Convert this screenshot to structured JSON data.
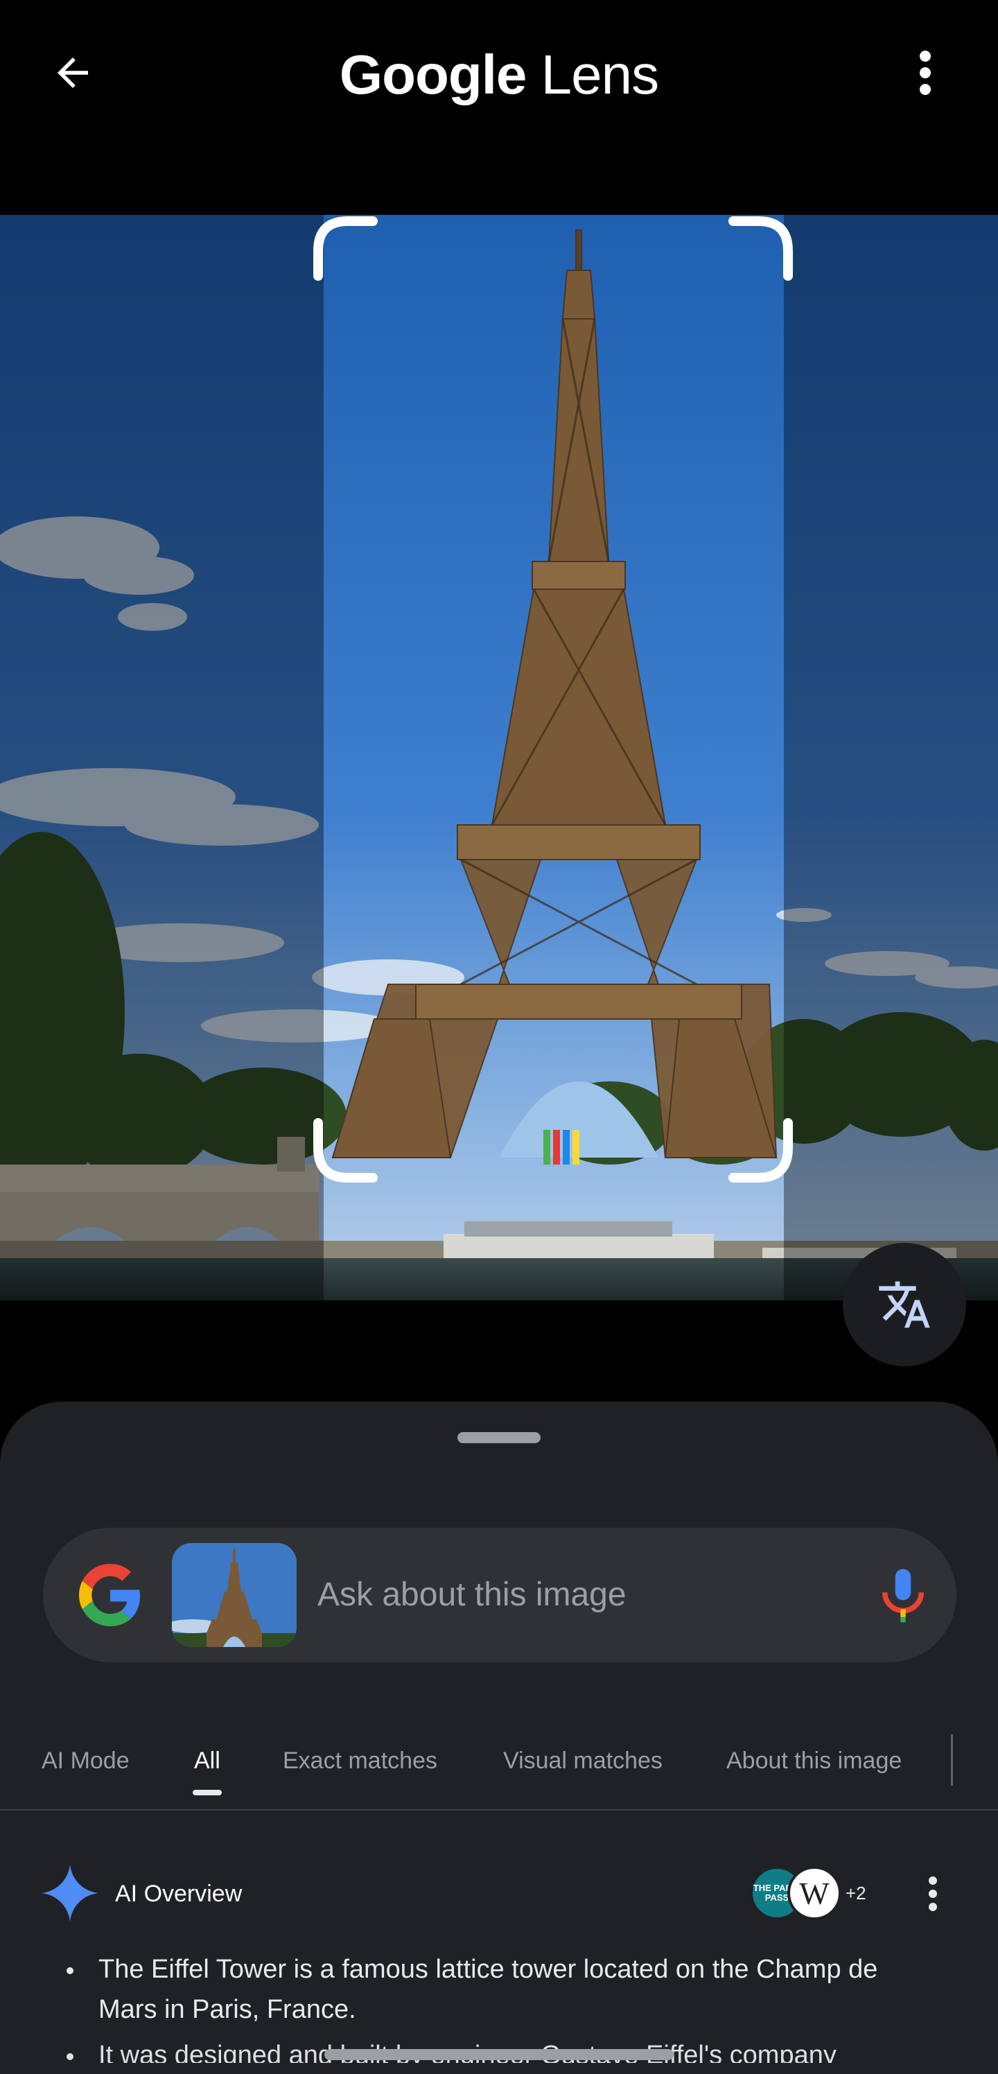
{
  "app_bar": {
    "title_google": "Google",
    "title_lens": "Lens",
    "back_icon": "arrow-left-icon",
    "more_icon": "more-vert-icon"
  },
  "photo": {
    "subject": "eiffel-tower-photo",
    "translate_icon": "translate-icon"
  },
  "search": {
    "placeholder": "Ask about this image",
    "logo_icon": "google-g-icon",
    "mic_icon": "mic-icon"
  },
  "tabs": [
    {
      "label": "AI Mode",
      "active": false
    },
    {
      "label": "All",
      "active": true
    },
    {
      "label": "Exact matches",
      "active": false
    },
    {
      "label": "Visual matches",
      "active": false
    },
    {
      "label": "About this image",
      "active": false
    }
  ],
  "overview": {
    "title": "AI Overview",
    "source_a": "THE PARIS PASS",
    "source_b": "W",
    "source_count": "+2",
    "bullets": [
      "The Eiffel Tower is a famous lattice tower located on the Champ de Mars in Paris, France.",
      "It was designed and built by engineer Gustave Eiffel's company"
    ]
  },
  "colors": {
    "background": "#000000",
    "sheet": "#202124",
    "search_bar": "#303134",
    "accent_blue": "#4285F4",
    "accent_red": "#EA4335",
    "accent_yellow": "#FBBC05",
    "accent_green": "#34A853"
  }
}
